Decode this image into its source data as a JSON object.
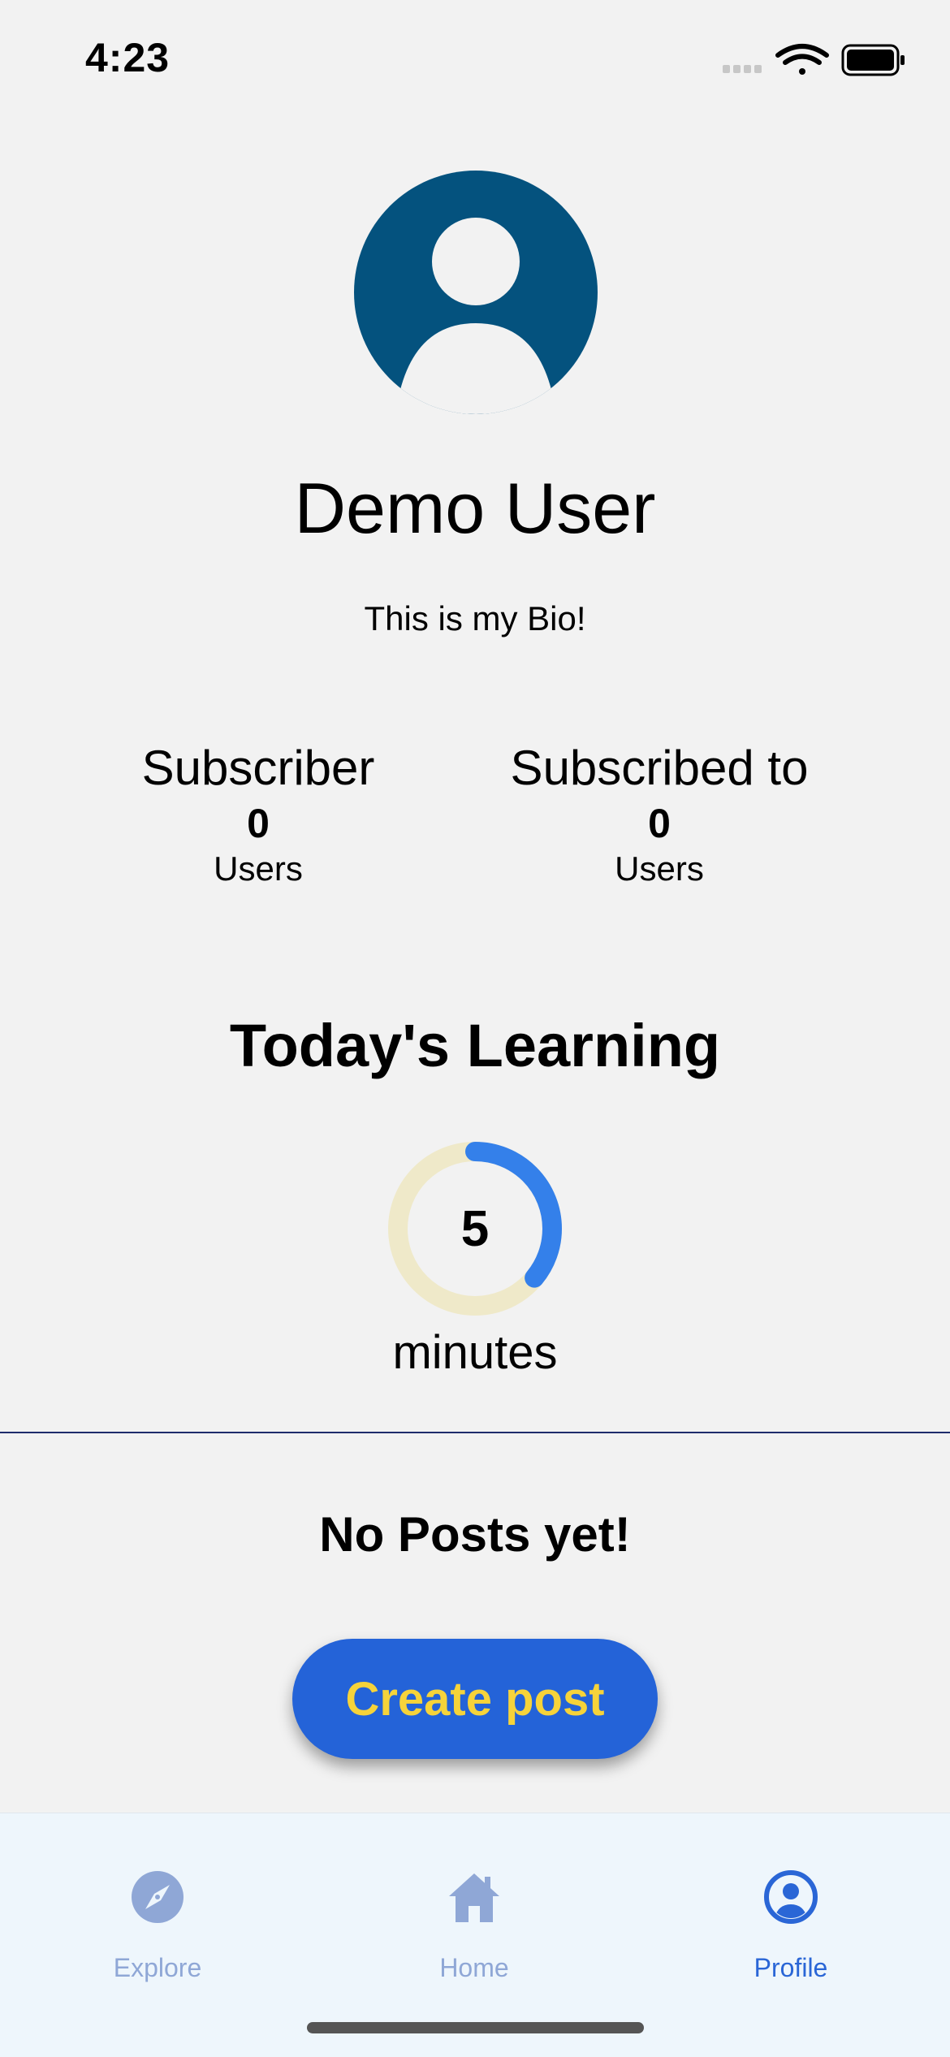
{
  "status_bar": {
    "time": "4:23",
    "icons": [
      "signal-icon",
      "wifi-icon",
      "battery-icon"
    ]
  },
  "profile": {
    "avatar_icon": "user-avatar-icon",
    "name": "Demo User",
    "bio": "This is my Bio!"
  },
  "stats": [
    {
      "title": "Subscriber",
      "count": "0",
      "unit": "Users"
    },
    {
      "title": "Subscribed to",
      "count": "0",
      "unit": "Users"
    }
  ],
  "learning": {
    "title": "Today's Learning",
    "value": "5",
    "unit": "minutes",
    "progress_fraction": 0.36
  },
  "posts": {
    "empty_text": "No Posts yet!",
    "create_label": "Create post"
  },
  "tab_bar": {
    "tabs": [
      {
        "label": "Explore",
        "icon": "compass-icon",
        "active": false
      },
      {
        "label": "Home",
        "icon": "home-icon",
        "active": false
      },
      {
        "label": "Profile",
        "icon": "profile-icon",
        "active": true
      }
    ]
  },
  "colors": {
    "background": "#f2f2f2",
    "avatar": "#04527e",
    "ring_track": "#efe9c9",
    "ring_progress": "#3480ea",
    "button_bg": "#2463d8",
    "button_text": "#f6d33a",
    "tab_active": "#2a66d6",
    "tab_inactive": "#8fa7d6",
    "divider": "#1f2c6b"
  }
}
